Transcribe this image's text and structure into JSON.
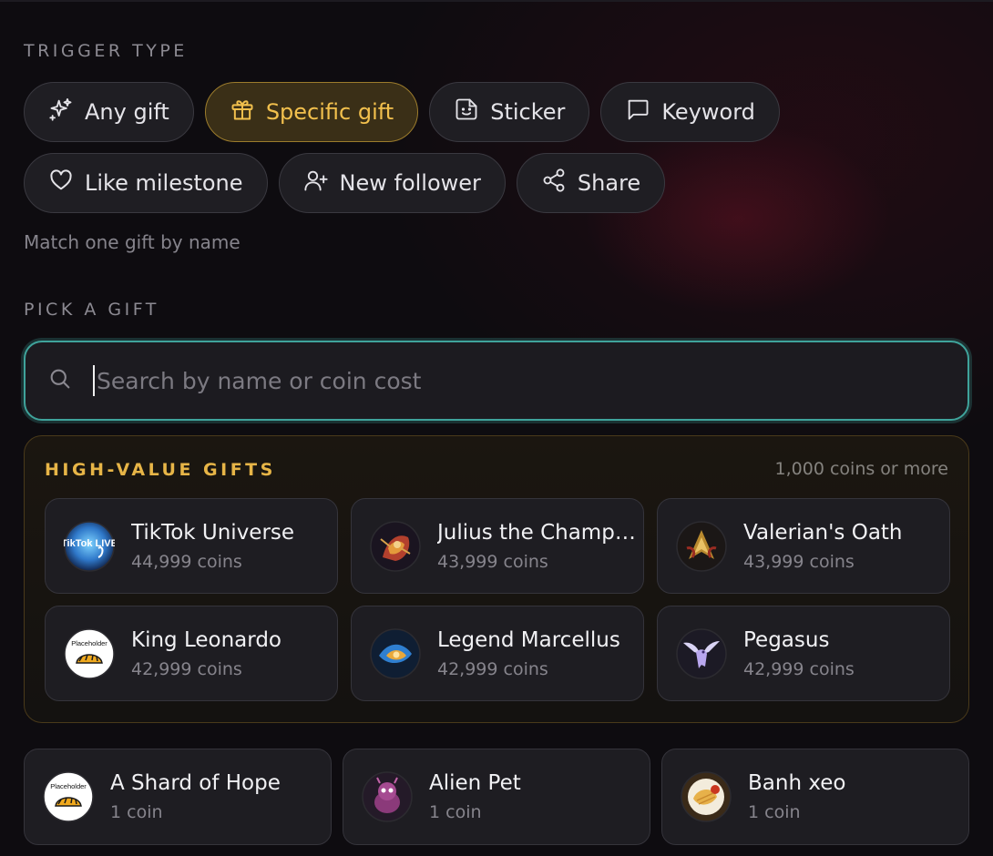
{
  "trigger": {
    "label": "TRIGGER TYPE",
    "chips": [
      {
        "label": "Any gift",
        "icon": "sparkles-icon",
        "active": false
      },
      {
        "label": "Specific gift",
        "icon": "gift-icon",
        "active": true
      },
      {
        "label": "Sticker",
        "icon": "sticker-icon",
        "active": false
      },
      {
        "label": "Keyword",
        "icon": "message-square-icon",
        "active": false
      },
      {
        "label": "Like milestone",
        "icon": "heart-icon",
        "active": false
      },
      {
        "label": "New follower",
        "icon": "user-plus-icon",
        "active": false
      },
      {
        "label": "Share",
        "icon": "share-icon",
        "active": false
      }
    ],
    "hint": "Match one gift by name"
  },
  "pick": {
    "label": "PICK A GIFT",
    "search_placeholder": "Search by name or coin cost"
  },
  "high_value": {
    "title": "HIGH-VALUE GIFTS",
    "subtitle": "1,000 coins or more",
    "gifts": [
      {
        "name": "TikTok Universe",
        "cost": "44,999 coins",
        "icon": "tiktok-universe-icon"
      },
      {
        "name": "Julius the Champion",
        "cost": "43,999 coins",
        "icon": "julius-icon"
      },
      {
        "name": "Valerian's Oath",
        "cost": "43,999 coins",
        "icon": "valerian-icon"
      },
      {
        "name": "King Leonardo",
        "cost": "42,999 coins",
        "icon": "placeholder-taco-icon"
      },
      {
        "name": "Legend Marcellus",
        "cost": "42,999 coins",
        "icon": "marcellus-icon"
      },
      {
        "name": "Pegasus",
        "cost": "42,999 coins",
        "icon": "pegasus-icon"
      }
    ]
  },
  "gifts": [
    {
      "name": "A Shard of Hope",
      "cost": "1 coin",
      "icon": "placeholder-taco-icon"
    },
    {
      "name": "Alien Pet",
      "cost": "1 coin",
      "icon": "alien-pet-icon"
    },
    {
      "name": "Banh xeo",
      "cost": "1 coin",
      "icon": "banh-xeo-icon"
    }
  ],
  "placeholder_text": "Placeholder",
  "tiktok_live_text": "TikTok LIVE",
  "colors": {
    "accent_gold": "#f2c04d",
    "accent_teal": "#3fa39b",
    "background": "#0e0c10"
  }
}
